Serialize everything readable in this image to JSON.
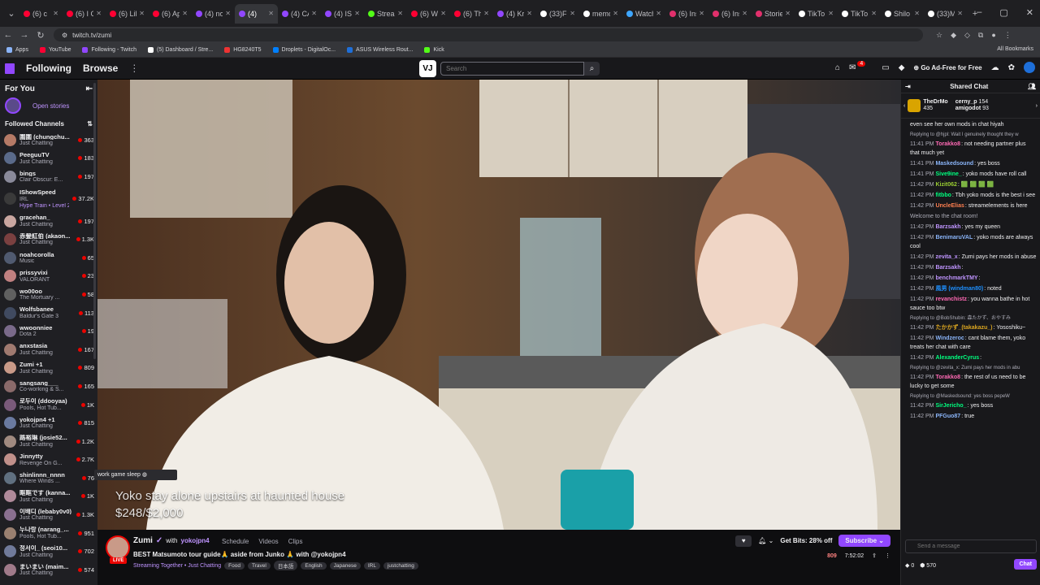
{
  "browser": {
    "tabs": [
      {
        "label": "(6) c",
        "color": "#ff0033"
      },
      {
        "label": "(6) I C",
        "color": "#ff0033"
      },
      {
        "label": "(6) Lil",
        "color": "#ff0033"
      },
      {
        "label": "(6) Ap",
        "color": "#ff0033"
      },
      {
        "label": "(4) no",
        "color": "#9147ff"
      },
      {
        "label": "(4)",
        "color": "#9147ff",
        "active": true
      },
      {
        "label": "(4) CA",
        "color": "#9147ff"
      },
      {
        "label": "(4) IS",
        "color": "#9147ff"
      },
      {
        "label": "Strea",
        "color": "#53fc18"
      },
      {
        "label": "(6) W",
        "color": "#ff0033"
      },
      {
        "label": "(6) Th",
        "color": "#ff0033"
      },
      {
        "label": "(4) Kr",
        "color": "#9147ff"
      },
      {
        "label": "(33)F",
        "color": "#ffffff"
      },
      {
        "label": "memo",
        "color": "#ffffff"
      },
      {
        "label": "Watch",
        "color": "#3ea6ff"
      },
      {
        "label": "(6) Ins",
        "color": "#e1306c"
      },
      {
        "label": "(6) Ins",
        "color": "#e1306c"
      },
      {
        "label": "Storie",
        "color": "#e1306c"
      },
      {
        "label": "TikTo",
        "color": "#ffffff"
      },
      {
        "label": "TikTo",
        "color": "#ffffff"
      },
      {
        "label": "Shilo",
        "color": "#ffffff"
      },
      {
        "label": "(33)M",
        "color": "#ffffff"
      }
    ],
    "url": "twitch.tv/zumi",
    "bookmarks": [
      {
        "label": "Apps",
        "color": "#8ab4f8"
      },
      {
        "label": "YouTube",
        "color": "#ff0033"
      },
      {
        "label": "Following - Twitch",
        "color": "#9147ff"
      },
      {
        "label": "(5) Dashboard / Stre...",
        "color": "#ffffff"
      },
      {
        "label": "HG8240T5",
        "color": "#e33"
      },
      {
        "label": "Droplets - DigitalOc...",
        "color": "#0080ff"
      },
      {
        "label": "ASUS Wireless Rout...",
        "color": "#1e6fd9"
      },
      {
        "label": "Kick",
        "color": "#53fc18"
      }
    ],
    "all_bookmarks": "All Bookmarks"
  },
  "nav": {
    "following": "Following",
    "browse": "Browse",
    "more": "⋮",
    "logo_text": "VJ",
    "search_placeholder": "Search",
    "notif_count": "4",
    "ad_free": "Go Ad-Free for Free"
  },
  "sidebar": {
    "title": "For You",
    "open_stories": "Open stories",
    "followed_title": "Followed Channels",
    "channels": [
      {
        "name": "圍圍 (chungchu...",
        "game": "Just Chatting",
        "viewers": "363",
        "color": "#b57a66"
      },
      {
        "name": "PeeguuTV",
        "game": "Just Chatting",
        "viewers": "183",
        "color": "#5a6a8a"
      },
      {
        "name": "bings",
        "game": "Clair Obscur: E...",
        "viewers": "197",
        "color": "#8a8a9a"
      },
      {
        "name": "IShowSpeed",
        "game": "IRL",
        "viewers": "37.2K",
        "color": "#3a3a3a",
        "extra": "Hype Train • Level 2"
      },
      {
        "name": "gracehan_",
        "game": "Just Chatting",
        "viewers": "197",
        "color": "#c9a6a0"
      },
      {
        "name": "赤髮紅伯 (akaon...",
        "game": "Just Chatting",
        "viewers": "1.3K",
        "color": "#7a4040"
      },
      {
        "name": "noahcorolla",
        "game": "Music",
        "viewers": "65",
        "color": "#505a70"
      },
      {
        "name": "prissyvixi",
        "game": "VALORANT",
        "viewers": "23",
        "color": "#c08080"
      },
      {
        "name": "wo00oo",
        "game": "The Mortuary ...",
        "viewers": "58",
        "color": "#606060"
      },
      {
        "name": "Wolfsbanee",
        "game": "Baldur's Gate 3",
        "viewers": "113",
        "color": "#404a60"
      },
      {
        "name": "wwoonniee",
        "game": "Dota 2",
        "viewers": "19",
        "color": "#7a6a8a"
      },
      {
        "name": "anxstasia",
        "game": "Just Chatting",
        "viewers": "167",
        "color": "#a07a70"
      },
      {
        "name": "Zumi +1",
        "game": "Just Chatting",
        "viewers": "809",
        "color": "#c99a88"
      },
      {
        "name": "sangsang___",
        "game": "Co-working & S...",
        "viewers": "165",
        "color": "#8a6a6a"
      },
      {
        "name": "로두이 (ddooyaa)",
        "game": "Pools, Hot Tub...",
        "viewers": "1K",
        "color": "#7a5a7a"
      },
      {
        "name": "yokojpn4 +1",
        "game": "Just Chatting",
        "viewers": "815",
        "color": "#6a7aa0"
      },
      {
        "name": "路裕琳 (josie52...",
        "game": "Just Chatting",
        "viewers": "1.2K",
        "color": "#a08a80"
      },
      {
        "name": "Jinnytty",
        "game": "Revenge On G...",
        "viewers": "2.7K",
        "color": "#c0908a"
      },
      {
        "name": "shinlinnn_nnnn",
        "game": "Where Winds ...",
        "viewers": "76",
        "color": "#607080"
      },
      {
        "name": "眶眶です (kanna...",
        "game": "Just Chatting",
        "viewers": "1K",
        "color": "#b08a9a"
      },
      {
        "name": "이배디 (lebaby0v0)",
        "game": "Just Chatting",
        "viewers": "1.3K",
        "color": "#8a7090"
      },
      {
        "name": "누나랑 (narang_...",
        "game": "Pools, Hot Tub...",
        "viewers": "951",
        "color": "#9a8070"
      },
      {
        "name": "정서이_ (seoi10...",
        "game": "Just Chatting",
        "viewers": "702",
        "color": "#707a9a"
      },
      {
        "name": "まいまい (maim...",
        "game": "Just Chatting",
        "viewers": "574",
        "color": "#a07a8a"
      }
    ],
    "tooltip": "work game sleep"
  },
  "video": {
    "overlay_title": "Yoko stay alone upstairs at haunted house",
    "overlay_goal": "$248/$2,000"
  },
  "stream": {
    "streamer": "Zumi",
    "with": "with",
    "co": "yokojpn4",
    "live": "LIVE",
    "tabs": [
      "Schedule",
      "Videos",
      "Clips"
    ],
    "title": "BEST Matsumoto tour guide🙏 aside from Junko 🙏 with @yokojpn4",
    "category": "Streaming Together • Just Chatting",
    "tags": [
      "Food",
      "Travel",
      "日本語",
      "English",
      "Japanese",
      "IRL",
      "justchatting"
    ],
    "bits": "Get Bits: 28% off",
    "subscribe": "Subscribe",
    "viewers": "809",
    "uptime": "7:52:02"
  },
  "chat": {
    "title": "Shared Chat",
    "pinned_user": "TheDrMo",
    "pinned_count": "435",
    "pinned_a": "cerny_p",
    "pinned_a_count": "154",
    "pinned_b": "amigodot",
    "pinned_b_count": "93",
    "messages": [
      {
        "text": "even see her own mods in chat hiyah"
      },
      {
        "reply": "Replying to @hjpl: Wait I genuinely thought they w",
        "ts": "11:41 PM",
        "user": "Torakko8",
        "color": "#ff69b4",
        "text": "not needing partner plus that much yet"
      },
      {
        "ts": "11:41 PM",
        "user": "Maskedsound",
        "color": "#8ab4f8",
        "text": "yes boss"
      },
      {
        "ts": "11:41 PM",
        "user": "Sive9ine_",
        "color": "#00ff7f",
        "text": "yoko mods have roll call"
      },
      {
        "ts": "11:42 PM",
        "user": "Kizit062",
        "color": "#9acd32",
        "text": "🟩 🟩 🟩 🟩"
      },
      {
        "ts": "11:42 PM",
        "user": "fitbbo",
        "color": "#00ff7f",
        "text": "Tbh yoko mods is the best i see"
      },
      {
        "ts": "11:42 PM",
        "user": "UncleElias",
        "color": "#ff7f50",
        "text": "streamelements is here"
      },
      {
        "system": "Welcome to the chat room!"
      },
      {
        "ts": "11:42 PM",
        "user": "Barzsakh",
        "color": "#bf94ff",
        "text": "yes my queen"
      },
      {
        "ts": "11:42 PM",
        "user": "BenimaruVAL",
        "color": "#8ab4f8",
        "text": "yoko mods are always cool"
      },
      {
        "ts": "11:42 PM",
        "user": "zevita_x",
        "color": "#bf94ff",
        "text": "Zumi pays her mods in abuse"
      },
      {
        "ts": "11:42 PM",
        "user": "Barzsakh",
        "color": "#bf94ff",
        "text": ""
      },
      {
        "ts": "11:42 PM",
        "user": "benchmarkTMY",
        "color": "#bf94ff",
        "text": ""
      },
      {
        "ts": "11:42 PM",
        "user": "風男 (windman80)",
        "color": "#1e90ff",
        "text": "noted"
      },
      {
        "ts": "11:42 PM",
        "user": "revanchistz",
        "color": "#ff69b4",
        "text": "you wanna bathe in hot sauce too btw"
      },
      {
        "reply": "Replying to @BobShubin: 森たかず、おやすみ",
        "ts": "11:42 PM",
        "user": "たかかず_(takakazu_)",
        "color": "#daa520",
        "text": "Yososhiku~"
      },
      {
        "ts": "11:42 PM",
        "user": "Windzeroc",
        "color": "#8ab4f8",
        "text": "cant blame them, yoko treats her chat with care"
      },
      {
        "ts": "11:42 PM",
        "user": "AlexanderCyrus",
        "color": "#00ff7f",
        "text": ""
      },
      {
        "reply": "Replying to @zevita_x: Zumi pays her mods in abu",
        "ts": "11:42 PM",
        "user": "Torakko8",
        "color": "#ff69b4",
        "text": "the rest of us need to be lucky to get some"
      },
      {
        "reply": "Replying to @Maskedsound: yes boss pepeW",
        "ts": "11:42 PM",
        "user": "SirJericho_",
        "color": "#00ff7f",
        "text": "yes boss"
      },
      {
        "ts": "11:42 PM",
        "user": "PFGuo87",
        "color": "#8ab4f8",
        "text": "true"
      }
    ],
    "input_placeholder": "Send a message",
    "points": "570",
    "bits_count": "0",
    "chat_button": "Chat"
  }
}
